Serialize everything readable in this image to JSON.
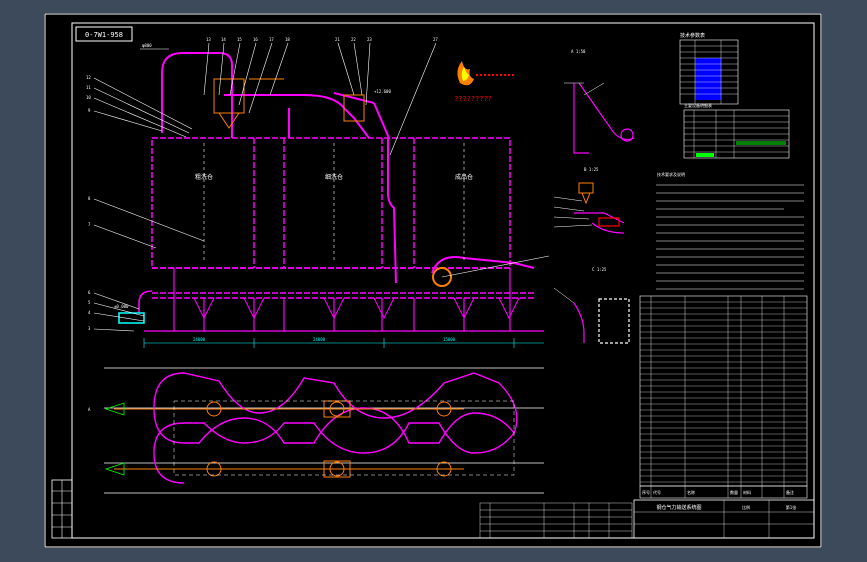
{
  "drawing": {
    "stamp": "0-7W1-958",
    "marks": {
      "pipe_label": "φ800",
      "chamber_1": "粗洗仓",
      "chamber_2": "细洗仓",
      "chamber_3": "成品仓",
      "question_text": "?????????",
      "view_a": "A 1:50",
      "view_b": "B 1:25",
      "view_c": "C 1:25",
      "dim_1": "24000",
      "dim_2": "24000",
      "dim_3": "15000",
      "elev_1": "±0.000",
      "elev_2": "+12.600"
    },
    "tech_table_title": "技术参数表",
    "valve_table_title": "主要设备明细表",
    "notes_title": "技术要求及说明",
    "title_block_name": "钢仓气力输送系统图",
    "title_block_scale": "比例",
    "title_block_sheet": "第1张",
    "parts_list_header": [
      "序号",
      "代号",
      "名称",
      "数量",
      "材料",
      "备注"
    ],
    "colors": {
      "background": "#3c4a5c",
      "canvas": "#000000",
      "outline": "#ffffff",
      "pipe": "#ff00ff",
      "pipe_detail": "#ff7f00",
      "leader": "#ffffff",
      "dim": "#00ffff",
      "text": "#ffffff",
      "highlight": "#0000ff",
      "accent_red": "#ff0000",
      "accent_yellow": "#ffff00",
      "accent_green": "#00ff00"
    }
  }
}
